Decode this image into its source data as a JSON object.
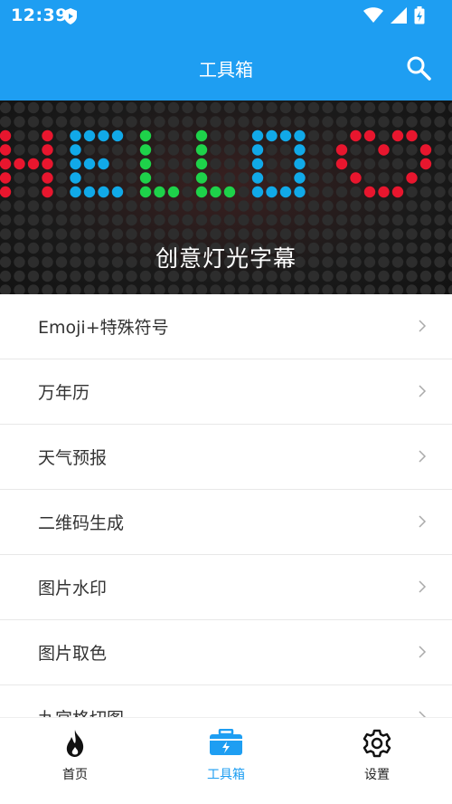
{
  "status_bar": {
    "time": "12:39"
  },
  "app_bar": {
    "title": "工具箱",
    "search_icon": "search-icon"
  },
  "banner": {
    "sign_text": "HELLO ♡",
    "caption": "创意灯光字幕",
    "colors": {
      "H": "#e8162e",
      "E": "#11a9e8",
      "L": "#1ed24a",
      "O": "#11a9e8",
      "heart": "#e8162e"
    }
  },
  "menu": {
    "items": [
      {
        "label": "Emoji+特殊符号"
      },
      {
        "label": "万年历"
      },
      {
        "label": "天气预报"
      },
      {
        "label": "二维码生成"
      },
      {
        "label": "图片水印"
      },
      {
        "label": "图片取色"
      },
      {
        "label": "九宫格切图"
      }
    ]
  },
  "tab_bar": {
    "tabs": [
      {
        "label": "首页",
        "icon": "flame-icon"
      },
      {
        "label": "工具箱",
        "icon": "toolbox-icon",
        "active": true
      },
      {
        "label": "设置",
        "icon": "gear-icon"
      }
    ],
    "accent": "#1e9ef2"
  }
}
